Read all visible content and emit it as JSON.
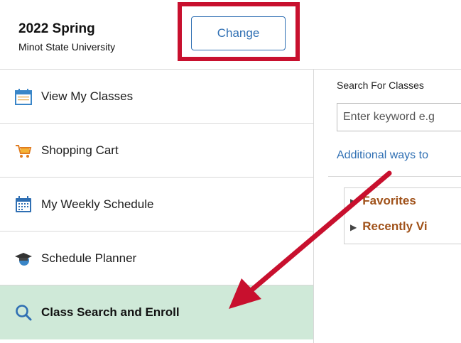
{
  "header": {
    "term": "2022 Spring",
    "institution": "Minot State University",
    "change_label": "Change"
  },
  "sidebar": {
    "items": [
      {
        "label": "View My Classes",
        "icon": "calendar-icon"
      },
      {
        "label": "Shopping Cart",
        "icon": "shopping-cart-icon"
      },
      {
        "label": "My Weekly Schedule",
        "icon": "weekly-calendar-icon"
      },
      {
        "label": "Schedule Planner",
        "icon": "graduation-cap-icon"
      },
      {
        "label": "Class Search and Enroll",
        "icon": "search-icon",
        "active": true
      }
    ]
  },
  "search": {
    "title": "Search For Classes",
    "placeholder": "Enter keyword e.g",
    "additional_link": "Additional ways to"
  },
  "accordion": {
    "favorites": "Favorites",
    "recently_viewed": "Recently Vi"
  },
  "colors": {
    "highlight": "#c8102e",
    "active_bg": "#cfe9d8",
    "link_blue": "#2f6fb3",
    "accordion_orange": "#a0521a"
  }
}
